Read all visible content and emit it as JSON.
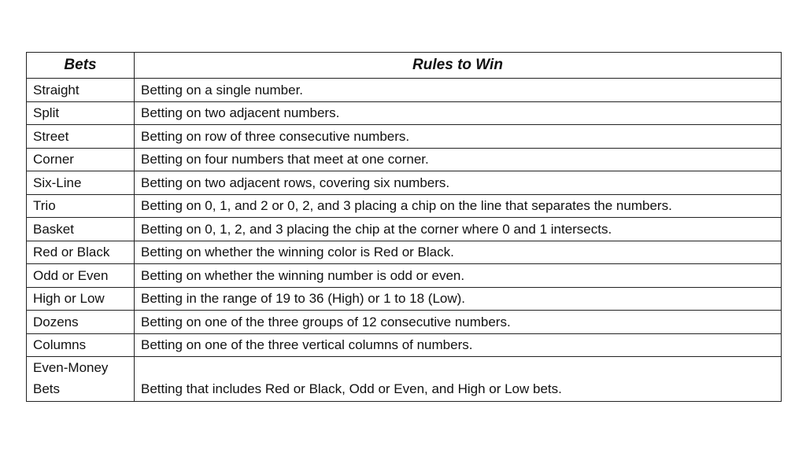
{
  "table": {
    "headers": [
      "Bets",
      "Rules to Win"
    ],
    "rows": [
      {
        "bet": "Straight",
        "rule": "Betting on a single number."
      },
      {
        "bet": "Split",
        "rule": "Betting on two adjacent numbers."
      },
      {
        "bet": "Street",
        "rule": "Betting on row of three consecutive numbers."
      },
      {
        "bet": "Corner",
        "rule": "Betting on four numbers that meet at one corner."
      },
      {
        "bet": "Six-Line",
        "rule": "Betting on two adjacent rows, covering six numbers."
      },
      {
        "bet": "Trio",
        "rule": "Betting on 0, 1, and 2 or 0, 2, and 3 placing a chip on the line that separates the numbers."
      },
      {
        "bet": "Basket",
        "rule": "Betting on 0, 1, 2, and 3 placing the chip at the corner where 0 and 1 intersects."
      },
      {
        "bet": "Red or Black",
        "rule": "Betting on whether the winning color is Red or Black."
      },
      {
        "bet": "Odd or Even",
        "rule": "Betting on whether the winning number is odd or even."
      },
      {
        "bet": "High or Low",
        "rule": "Betting in the range of 19 to 36 (High) or 1 to 18 (Low)."
      },
      {
        "bet": "Dozens",
        "rule": "Betting on one of the three groups of 12 consecutive numbers."
      },
      {
        "bet": "Columns",
        "rule": "Betting on one of the three vertical columns of numbers."
      },
      {
        "bet_line1": "Even-Money",
        "bet_line2": "Bets",
        "rule": "Betting that includes Red or Black, Odd or Even, and High or Low bets."
      }
    ]
  }
}
